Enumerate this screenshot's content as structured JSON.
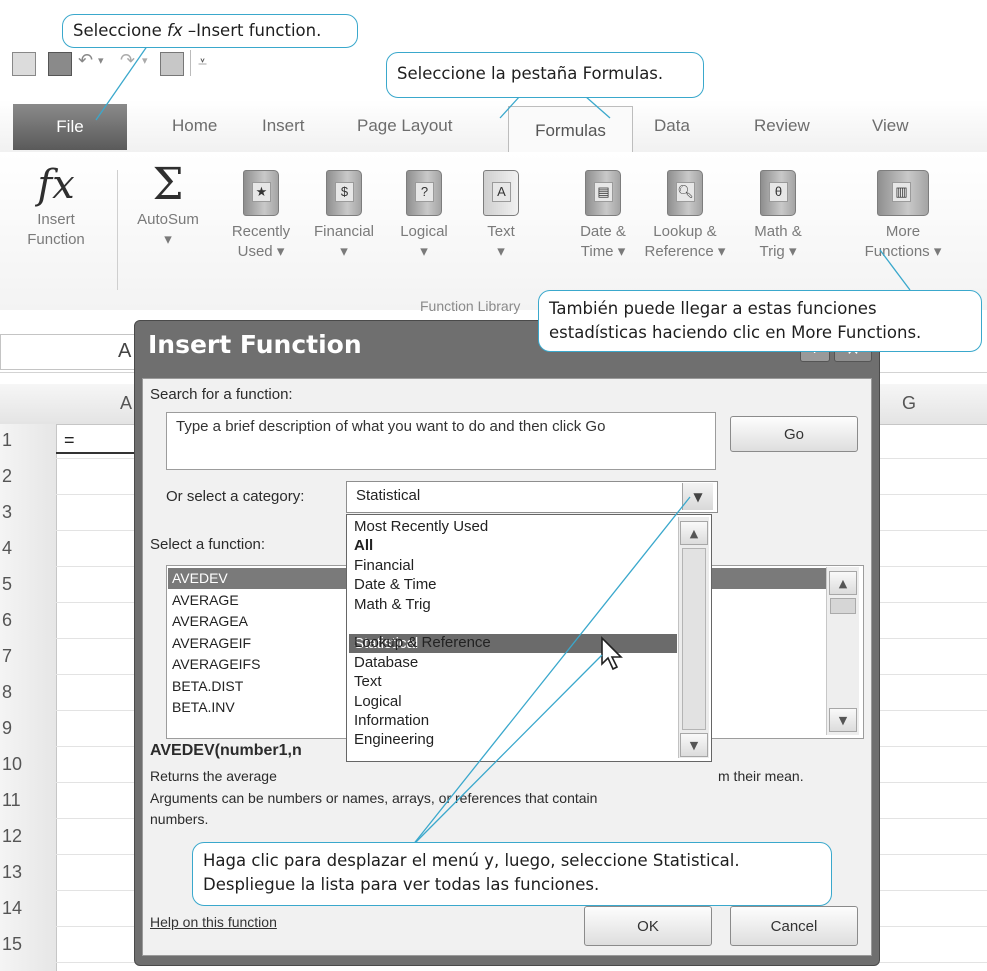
{
  "callouts": {
    "insert_fn_prefix": "Seleccione ",
    "insert_fn_fx": "fx",
    "insert_fn_suffix": " –Insert function.",
    "formulas_tab": "Seleccione la pestaña Formulas.",
    "more_functions_line1": "También puede llegar a estas funciones",
    "more_functions_line2": "estadísticas haciendo clic en More Functions.",
    "statistical_line1": "Haga clic para desplazar el menú y, luego, seleccione Statistical.",
    "statistical_line2": "Despliegue la lista para ver todas las funciones."
  },
  "ribbon": {
    "tabs": {
      "file": "File",
      "home": "Home",
      "insert": "Insert",
      "page_layout": "Page Layout",
      "formulas": "Formulas",
      "data": "Data",
      "review": "Review",
      "view": "View"
    },
    "buttons": {
      "insert_function_1": "Insert",
      "insert_function_2": "Function",
      "autosum": "AutoSum",
      "recently_used_1": "Recently",
      "recently_used_2": "Used",
      "financial": "Financial",
      "logical": "Logical",
      "text": "Text",
      "date_time_1": "Date &",
      "date_time_2": "Time",
      "lookup_1": "Lookup &",
      "lookup_2": "Reference",
      "math_1": "Math &",
      "math_2": "Trig",
      "more_1": "More",
      "more_2": "Functions"
    },
    "group_label": "Function Library"
  },
  "sheet": {
    "namebox_value": "A",
    "col_a": "A",
    "col_g": "G",
    "cell_a1": "=",
    "rows": [
      "1",
      "2",
      "3",
      "4",
      "5",
      "6",
      "7",
      "8",
      "9",
      "10",
      "11",
      "12",
      "13",
      "14",
      "15"
    ]
  },
  "dialog": {
    "title": "Insert Function",
    "search_label": "Search for a function:",
    "search_text": "Type a brief description of what you want to do and then click Go",
    "go_button": "Go",
    "category_label": "Or select a category:",
    "category_value": "Statistical",
    "select_function_label": "Select a function:",
    "functions": [
      "AVEDEV",
      "AVERAGE",
      "AVERAGEA",
      "AVERAGEIF",
      "AVERAGEIFS",
      "BETA.DIST",
      "BETA.INV"
    ],
    "categories": [
      "Most Recently Used",
      "All",
      "Financial",
      "Date & Time",
      "Math & Trig",
      "Statistical",
      "Lookup & Reference",
      "Database",
      "Text",
      "Logical",
      "Information",
      "Engineering"
    ],
    "signature": "AVEDEV(number1,n",
    "description_1": "Returns the average",
    "description_1b": "m their mean.",
    "description_2": "Arguments can be numbers or names, arrays, or references that contain",
    "description_3": "numbers.",
    "help_link": "Help on this function",
    "ok_button": "OK",
    "cancel_button": "Cancel"
  }
}
